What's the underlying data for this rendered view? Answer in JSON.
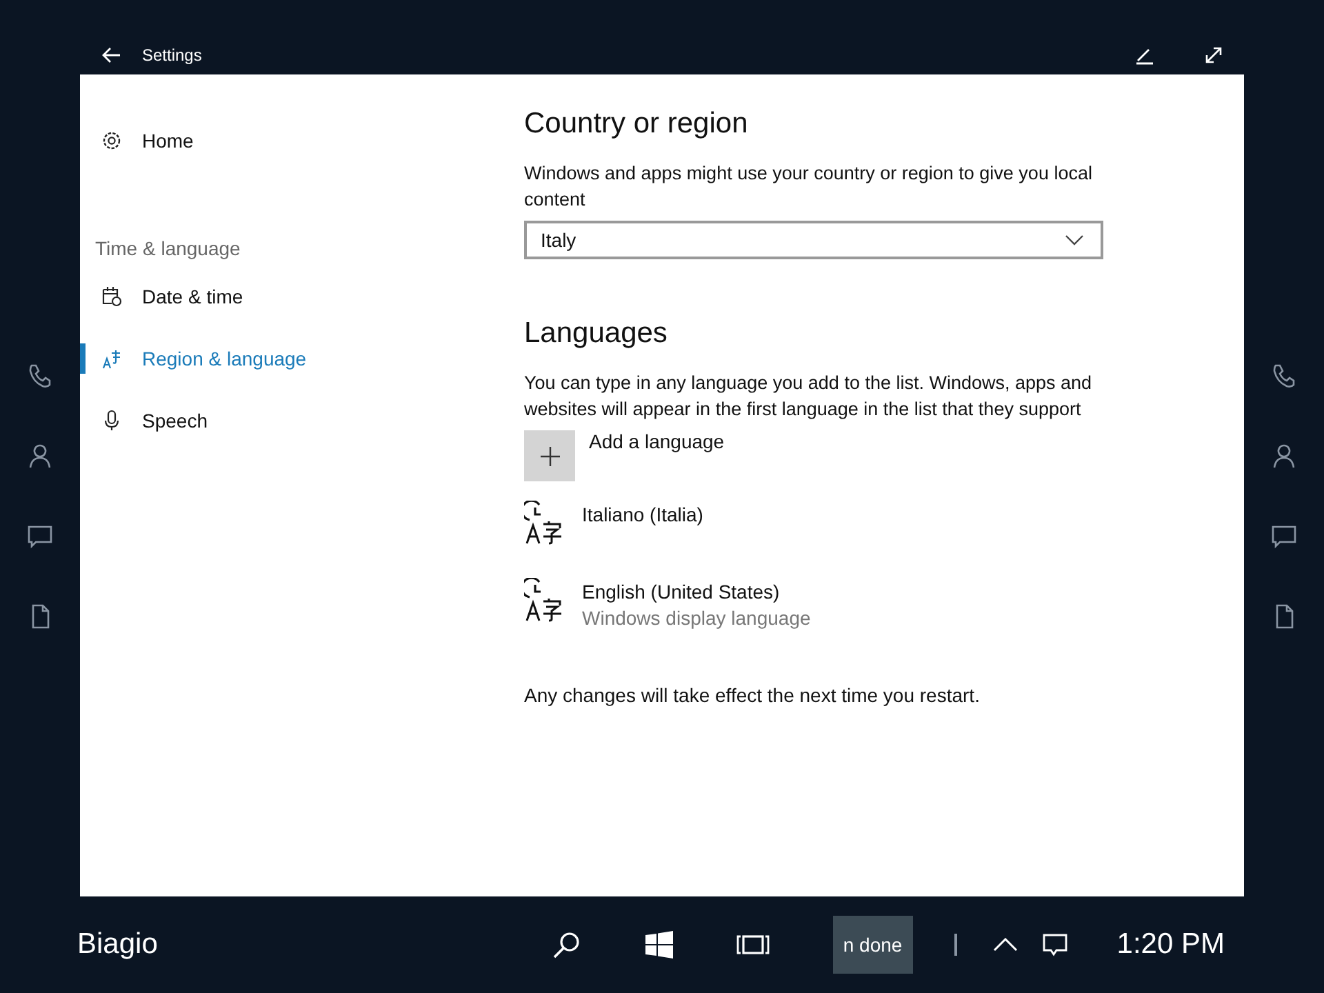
{
  "window": {
    "title": "Settings"
  },
  "rails": [
    {
      "kind": "phone"
    },
    {
      "kind": "person"
    },
    {
      "kind": "message"
    },
    {
      "kind": "document"
    }
  ],
  "sidebar": {
    "home": "Home",
    "section": "Time & language",
    "items": [
      {
        "label": "Date & time",
        "kind": "calendar",
        "selected": false
      },
      {
        "label": "Region & language",
        "kind": "language",
        "selected": true
      },
      {
        "label": "Speech",
        "kind": "microphone",
        "selected": false
      }
    ]
  },
  "country": {
    "heading": "Country or region",
    "description": "Windows and apps might use your country or region to give you local content",
    "value": "Italy"
  },
  "languages": {
    "heading": "Languages",
    "description": "You can type in any language you add to the list. Windows, apps and websites will appear in the first language in the list that they support",
    "add_label": "Add a language",
    "items": [
      {
        "name": "Italiano (Italia)"
      },
      {
        "name": "English (United States)",
        "detail": "Windows display language"
      }
    ],
    "note": "Any changes will take effect the next time you restart."
  },
  "taskbar": {
    "user": "Biagio",
    "notification": "n done",
    "time": "1:20 PM"
  }
}
